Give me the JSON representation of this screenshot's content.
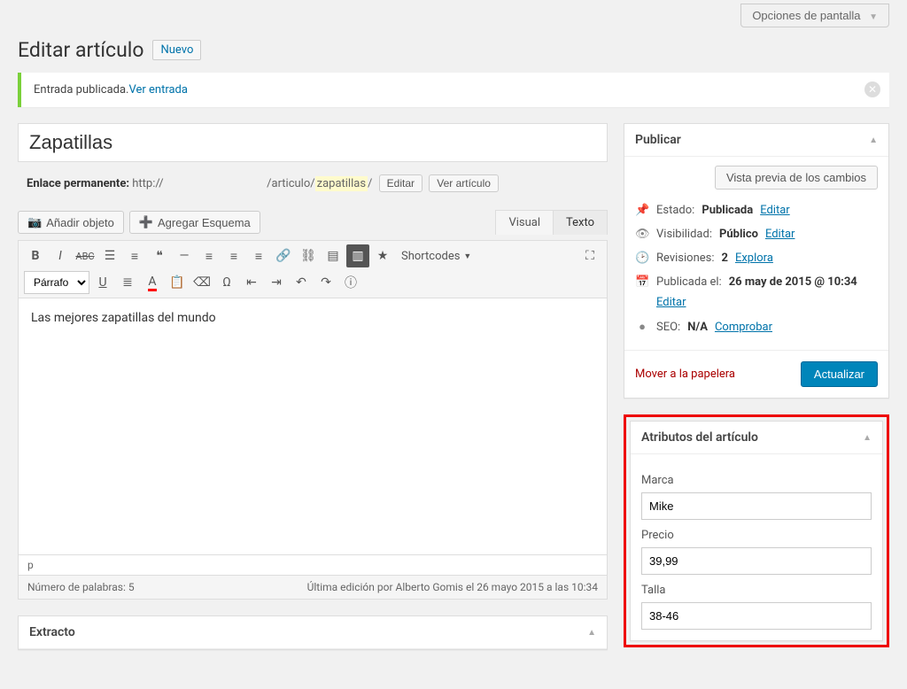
{
  "screen_options": "Opciones de pantalla",
  "page_title": "Editar artículo",
  "add_new": "Nuevo",
  "notice": {
    "text": "Entrada publicada. ",
    "link": "Ver entrada"
  },
  "post_title": "Zapatillas",
  "permalink": {
    "label": "Enlace permanente:",
    "prefix": "http://",
    "mid": "/articulo/",
    "slug": "zapatillas",
    "suffix": "/",
    "edit": "Editar",
    "view": "Ver artículo"
  },
  "media": {
    "add": "Añadir objeto",
    "schema": "Agregar Esquema"
  },
  "tabs": {
    "visual": "Visual",
    "text": "Texto"
  },
  "format_select": "Párrafo",
  "shortcodes_label": "Shortcodes",
  "editor_content": "Las mejores zapatillas del mundo",
  "status_path": "p",
  "status_bar": {
    "words": "Número de palabras: 5",
    "edited": "Última edición por Alberto Gomis el 26 mayo 2015 a las 10:34"
  },
  "excerpt_title": "Extracto",
  "publish": {
    "title": "Publicar",
    "preview": "Vista previa de los cambios",
    "state_label": "Estado:",
    "state_value": "Publicada",
    "state_edit": "Editar",
    "vis_label": "Visibilidad:",
    "vis_value": "Público",
    "vis_edit": "Editar",
    "rev_label": "Revisiones:",
    "rev_value": "2",
    "rev_link": "Explora",
    "pub_label": "Publicada el:",
    "pub_value": "26 may de 2015 @ 10:34",
    "pub_edit": "Editar",
    "seo_label": "SEO:",
    "seo_value": "N/A",
    "seo_link": "Comprobar",
    "trash": "Mover a la papelera",
    "update": "Actualizar"
  },
  "attributes": {
    "title": "Atributos del artículo",
    "fields": {
      "marca_label": "Marca",
      "marca_value": "Mike",
      "precio_label": "Precio",
      "precio_value": "39,99",
      "talla_label": "Talla",
      "talla_value": "38-46"
    }
  }
}
